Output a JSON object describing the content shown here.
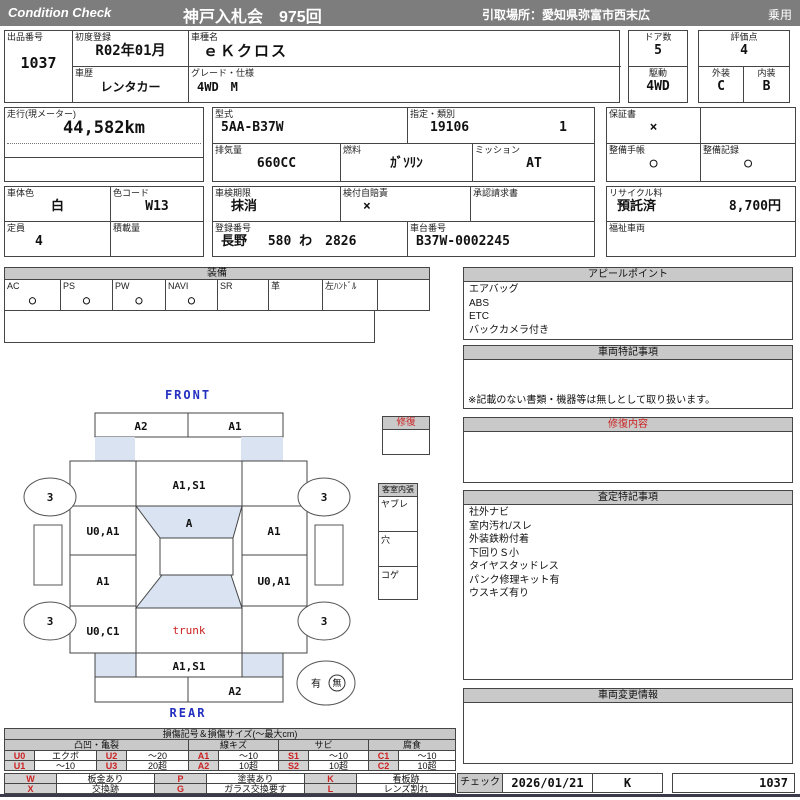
{
  "header": {
    "brand": "Condition  Check",
    "auction": "神戸入札会　975回",
    "pickup": "引取場所：愛知県弥富市西末広",
    "category": "乗用"
  },
  "info": {
    "lot_label": "出品番号",
    "lot": "1037",
    "first_reg_label": "初度登録",
    "first_reg": "R02年01月",
    "model_name_label": "車種名",
    "model_name": "ｅＫクロス",
    "history_label": "車歴",
    "history": "レンタカー",
    "grade_label": "グレード・仕様",
    "grade": "4WD　M",
    "doors_label": "ドア数",
    "doors": "5",
    "drive_label": "駆動",
    "drive": "4WD",
    "score_label": "評価点",
    "score": "4",
    "exterior_label": "外装",
    "exterior": "C",
    "interior_label": "内装",
    "interior": "B",
    "mileage_label": "走行(現メーター)",
    "mileage": "44,582km",
    "model_code_label": "型式",
    "model_code": "5AA-B37W",
    "class_label": "指定・類別",
    "class_no": "19106",
    "class_sub": "1",
    "displacement_label": "排気量",
    "displacement": "660CC",
    "fuel_label": "燃料",
    "fuel": "ｶﾞｿﾘﾝ",
    "mission_label": "ミッション",
    "mission": "AT",
    "warranty_label": "保証書",
    "warranty": "×",
    "maintenance_book_label": "整備手帳",
    "maintenance_book": "○",
    "maintenance_record_label": "整備記録",
    "maintenance_record": "○",
    "color_label": "車体色",
    "color": "白",
    "color_code_label": "色コード",
    "color_code": "W13",
    "inspection_label": "車検期限",
    "inspection": "抹消",
    "insurance_label": "検付自賠責",
    "insurance": "×",
    "approval_label": "承認請求書",
    "recycle_label": "リサイクル料",
    "recycle_status": "預託済",
    "recycle_fee": "8,700円",
    "capacity_label": "定員",
    "capacity": "4",
    "load_label": "積載量",
    "reg_no_label": "登録番号",
    "reg_no": "長野　 580 わ　2826",
    "chassis_label": "車台番号",
    "chassis": "B37W-0002245",
    "welfare_label": "福祉車両"
  },
  "equipment": {
    "title": "装備",
    "items": [
      {
        "label": "AC",
        "value": "○"
      },
      {
        "label": "PS",
        "value": "○"
      },
      {
        "label": "PW",
        "value": "○"
      },
      {
        "label": "NAVI",
        "value": "○"
      },
      {
        "label": "SR",
        "value": ""
      },
      {
        "label": "革",
        "value": ""
      },
      {
        "label": "左ﾊﾝﾄﾞﾙ",
        "value": ""
      },
      {
        "label": "",
        "value": ""
      }
    ]
  },
  "appeal": {
    "title": "アピールポイント",
    "lines": [
      "エアバッグ",
      "ABS",
      "ETC",
      "バックカメラ付き"
    ]
  },
  "vehicle_notes": {
    "title": "車両特記事項",
    "note": "※記載のない書類・機器等は無しとして取り扱います。"
  },
  "repair_content": {
    "title": "修復内容"
  },
  "repair_box": {
    "title": "修復"
  },
  "cabin": {
    "title": "客室内張",
    "rows": [
      "ヤブレ",
      "穴",
      "コゲ"
    ]
  },
  "assessment": {
    "title": "査定特記事項",
    "lines": [
      "社外ナビ",
      "室内汚れ/スレ",
      "外装鉄粉付着",
      "下回りＳ小",
      "タイヤスタッドレス",
      "パンク修理キット有",
      "ウスキズ有り"
    ]
  },
  "change_info": {
    "title": "車両変更情報"
  },
  "check": {
    "label": "チェック",
    "date": "2026/01/21",
    "inspector": "K",
    "number": "1037"
  },
  "diagram": {
    "front_label": "FRONT",
    "rear_label": "REAR",
    "front_bumper_left": "A2",
    "front_bumper_right": "A1",
    "hood": "A1,S1",
    "windshield": "A",
    "left_front_door": "U0,A1",
    "left_rear_door": "A1",
    "left_quarter": "U0,C1",
    "right_front_door": "A1",
    "right_rear_door": "U0,A1",
    "trunk": "trunk",
    "rear_panel": "A1,S1",
    "rear_bumper_right": "A2",
    "tire_fl": "3",
    "tire_fr": "3",
    "tire_rl": "3",
    "tire_rr": "3",
    "spare_have": "有",
    "spare_none": "無"
  },
  "legend": {
    "title": "損傷記号＆損傷サイズ(〜最大cm)",
    "groups": [
      "凸凹・亀裂",
      "線キズ",
      "サビ",
      "腐食"
    ],
    "rows": [
      [
        "U0",
        "エクボ",
        "U2",
        "〜20",
        "A1",
        "〜10",
        "S1",
        "〜10",
        "C1",
        "〜10"
      ],
      [
        "U1",
        "〜10",
        "U3",
        "20超",
        "A2",
        "10超",
        "S2",
        "10超",
        "C2",
        "10超"
      ]
    ],
    "marks": [
      [
        "W",
        "板金あり",
        "P",
        "塗装あり",
        "K",
        "看板跡"
      ],
      [
        "X",
        "交換跡",
        "G",
        "ガラス交換要す",
        "L",
        "レンズ割れ"
      ]
    ]
  },
  "colors": {
    "accent_blue": "#2330c0",
    "accent_red": "#cc2222",
    "glass_blue": "#d9e3f1",
    "header_gray": "#7d7d7d",
    "panel_gray": "#c9c9c9"
  }
}
